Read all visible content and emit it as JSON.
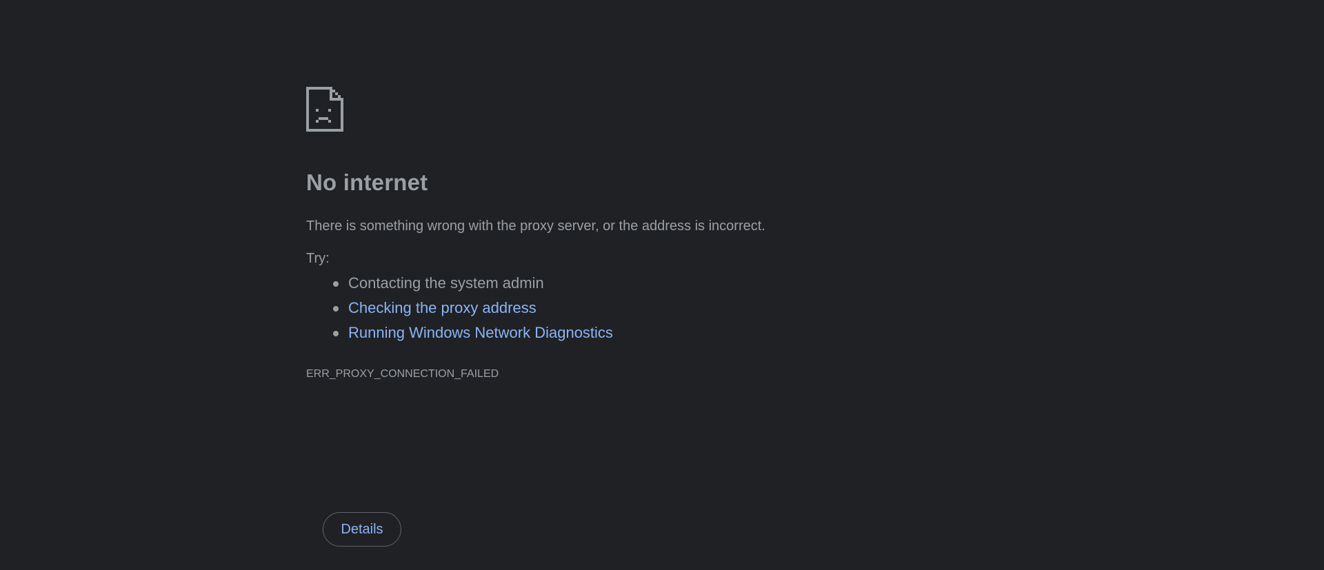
{
  "page": {
    "background": "#202124",
    "text_color": "#9aa0a6",
    "link_color": "#8ab4f8"
  },
  "icon": "sad-document-icon",
  "heading": "No internet",
  "summary": "There is something wrong with the proxy server, or the address is incorrect.",
  "try_label": "Try:",
  "suggestions": [
    {
      "text": "Contacting the system admin",
      "is_link": false
    },
    {
      "text": "Checking the proxy address",
      "is_link": true
    },
    {
      "text": "Running Windows Network Diagnostics",
      "is_link": true
    }
  ],
  "error_code": "ERR_PROXY_CONNECTION_FAILED",
  "details_button": "Details"
}
